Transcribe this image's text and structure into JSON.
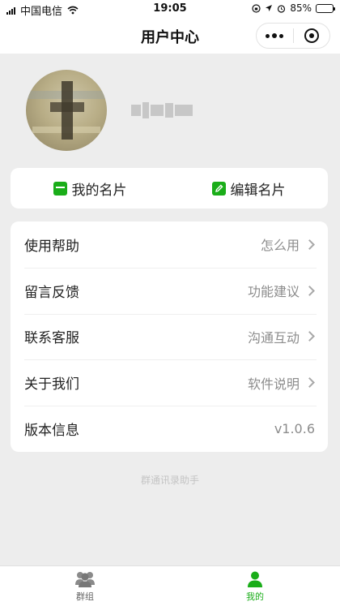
{
  "status_bar": {
    "carrier": "中国电信",
    "time": "19:05",
    "battery_percent": "85%",
    "battery_level": 0.85
  },
  "nav": {
    "title": "用户中心"
  },
  "profile": {
    "avatar_icon": "user-avatar-photo",
    "name_blurred": true
  },
  "card_buttons": [
    {
      "label": "我的名片",
      "icon": "card-icon"
    },
    {
      "label": "编辑名片",
      "icon": "edit-icon"
    }
  ],
  "menu": [
    {
      "label": "使用帮助",
      "value": "怎么用",
      "has_arrow": true
    },
    {
      "label": "留言反馈",
      "value": "功能建议",
      "has_arrow": true
    },
    {
      "label": "联系客服",
      "value": "沟通互动",
      "has_arrow": true
    },
    {
      "label": "关于我们",
      "value": "软件说明",
      "has_arrow": true
    },
    {
      "label": "版本信息",
      "value": "v1.0.6",
      "has_arrow": false
    }
  ],
  "footer": "群通讯录助手",
  "tabs": [
    {
      "label": "群组",
      "icon": "group-icon",
      "active": false
    },
    {
      "label": "我的",
      "icon": "person-icon",
      "active": true
    }
  ],
  "colors": {
    "accent": "#1aad19",
    "page_bg": "#ededed"
  }
}
